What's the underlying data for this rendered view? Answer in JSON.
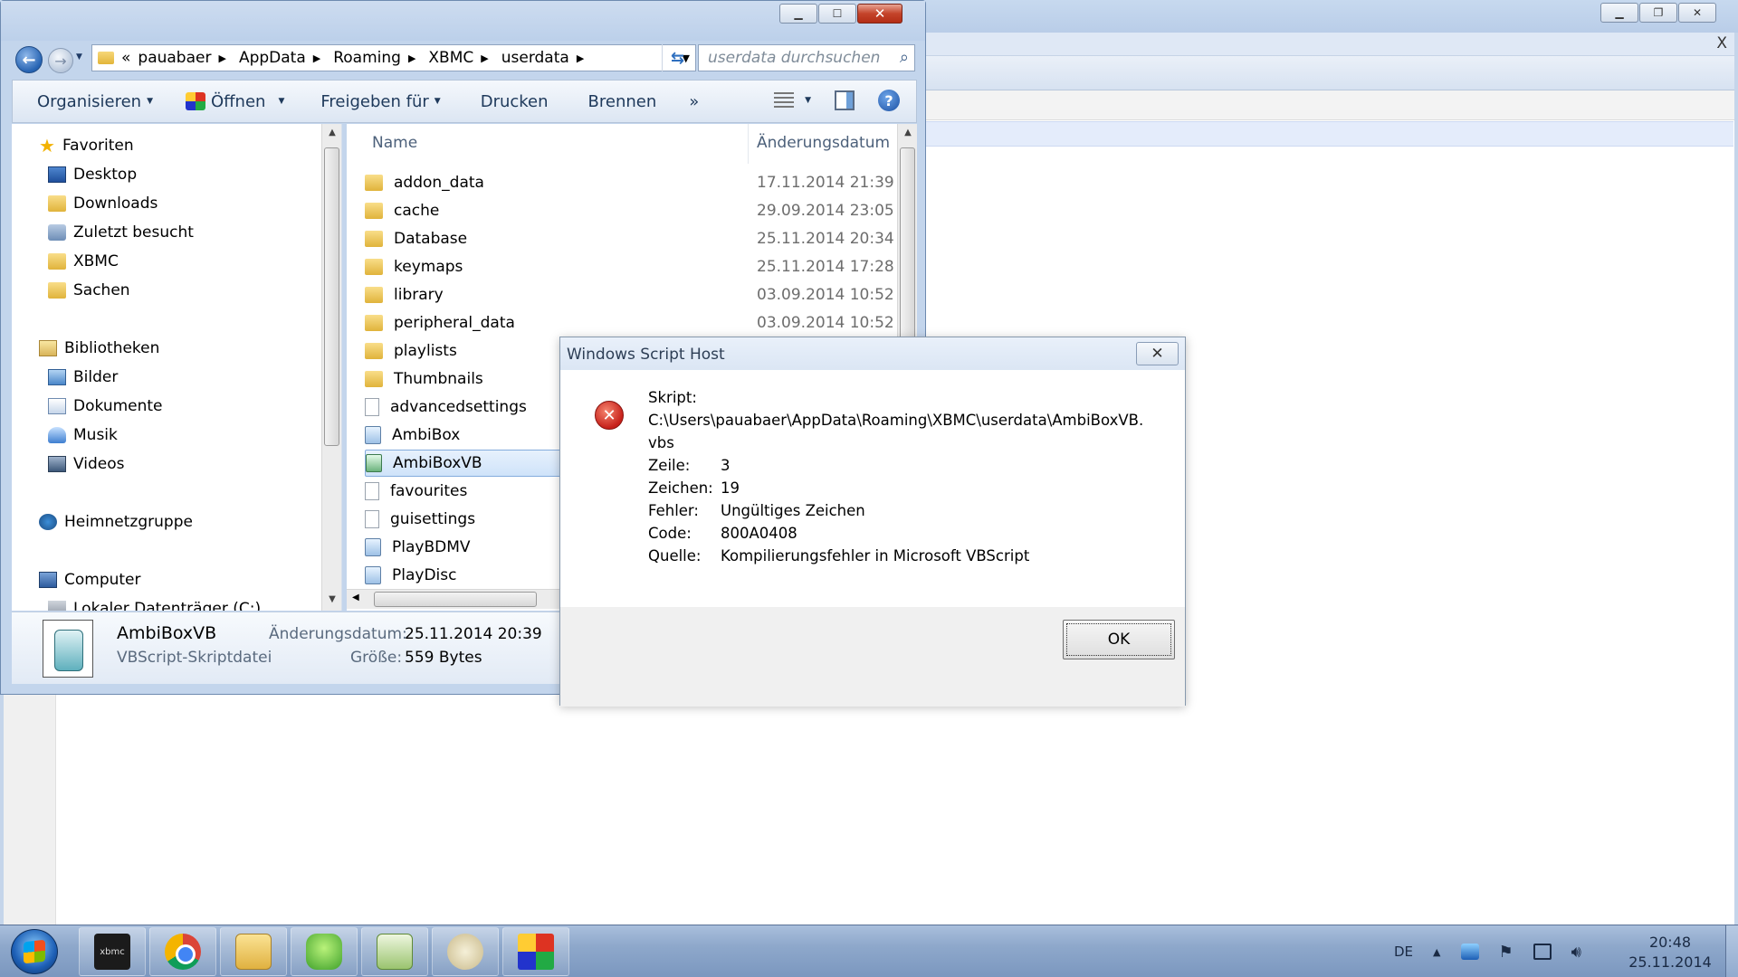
{
  "background_window": {
    "close_glyph": "X"
  },
  "explorer": {
    "address": {
      "overflow": "«",
      "crumbs": [
        "pauabaer",
        "AppData",
        "Roaming",
        "XBMC",
        "userdata"
      ]
    },
    "search_placeholder": "userdata durchsuchen",
    "toolbar": {
      "organize": "Organisieren",
      "open": "Öffnen",
      "share": "Freigeben für",
      "print": "Drucken",
      "burn": "Brennen",
      "more": "»"
    },
    "nav": {
      "favorites": "Favoriten",
      "desktop": "Desktop",
      "downloads": "Downloads",
      "recent": "Zuletzt besucht",
      "xbmc": "XBMC",
      "sachen": "Sachen",
      "libraries": "Bibliotheken",
      "pictures": "Bilder",
      "documents": "Dokumente",
      "music": "Musik",
      "videos": "Videos",
      "homegroup": "Heimnetzgruppe",
      "computer": "Computer",
      "local_disk": "Lokaler Datenträger (C:)"
    },
    "columns": {
      "name": "Name",
      "date": "Änderungsdatum"
    },
    "files": [
      {
        "name": "addon_data",
        "date": "17.11.2014 21:39",
        "icon": "folder-icon"
      },
      {
        "name": "cache",
        "date": "29.09.2014 23:05",
        "icon": "folder-icon"
      },
      {
        "name": "Database",
        "date": "25.11.2014 20:34",
        "icon": "folder-icon"
      },
      {
        "name": "keymaps",
        "date": "25.11.2014 17:28",
        "icon": "folder-icon"
      },
      {
        "name": "library",
        "date": "03.09.2014 10:52",
        "icon": "folder-icon"
      },
      {
        "name": "peripheral_data",
        "date": "03.09.2014 10:52",
        "icon": "folder-icon"
      },
      {
        "name": "playlists",
        "date": "",
        "icon": "folder-icon"
      },
      {
        "name": "Thumbnails",
        "date": "",
        "icon": "folder-icon"
      },
      {
        "name": "advancedsettings",
        "date": "",
        "icon": "file-icon"
      },
      {
        "name": "AmbiBox",
        "date": "",
        "icon": "script-icon"
      },
      {
        "name": "AmbiBoxVB",
        "date": "",
        "icon": "vbs-icon"
      },
      {
        "name": "favourites",
        "date": "",
        "icon": "file-icon"
      },
      {
        "name": "guisettings",
        "date": "",
        "icon": "file-icon"
      },
      {
        "name": "PlayBDMV",
        "date": "",
        "icon": "script-icon"
      },
      {
        "name": "PlayDisc",
        "date": "",
        "icon": "script-icon"
      }
    ],
    "details": {
      "name": "AmbiBoxVB",
      "type": "VBScript-Skriptdatei",
      "modified_label": "Änderungsdatum:",
      "modified_value": "25.11.2014 20:39",
      "size_label": "Größe:",
      "size_value": "559 Bytes"
    }
  },
  "dialog": {
    "title": "Windows Script Host",
    "script_label": "Skript:",
    "script_path_line1": "C:\\Users\\pauabaer\\AppData\\Roaming\\XBMC\\userdata\\AmbiBoxVB.",
    "script_path_line2": "vbs",
    "rows": [
      {
        "k": "Zeile:",
        "v": "3"
      },
      {
        "k": "Zeichen:",
        "v": "19"
      },
      {
        "k": "Fehler:",
        "v": "Ungültiges Zeichen"
      },
      {
        "k": "Code:",
        "v": "800A0408"
      },
      {
        "k": "Quelle:",
        "v": "Kompilierungsfehler in Microsoft VBScript"
      }
    ],
    "ok": "OK",
    "close_glyph": "✕"
  },
  "taskbar": {
    "xbmc_label": "xbmc",
    "lang": "DE",
    "time": "20:48",
    "date": "25.11.2014"
  }
}
